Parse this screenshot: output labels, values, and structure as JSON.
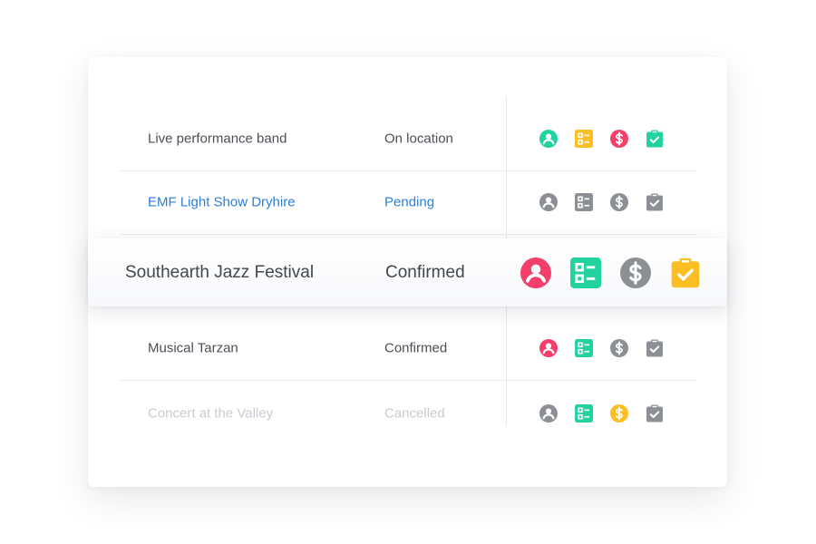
{
  "colors": {
    "teal": "#22d3a0",
    "yellow": "#fbbf24",
    "pink": "#f43f6b",
    "gray": "#8c8f94",
    "blue": "#2b7fd4",
    "faded_text": "#c8ccd2"
  },
  "rows": [
    {
      "name": "Live performance band",
      "status": "On location",
      "icons": [
        {
          "name": "person-icon",
          "color": "teal"
        },
        {
          "name": "checklist-icon",
          "color": "yellow"
        },
        {
          "name": "dollar-icon",
          "color": "pink"
        },
        {
          "name": "clipboard-check-icon",
          "color": "teal"
        }
      ]
    },
    {
      "name": "EMF Light Show Dryhire",
      "status": "Pending",
      "icons": [
        {
          "name": "person-icon",
          "color": "gray"
        },
        {
          "name": "checklist-icon",
          "color": "gray"
        },
        {
          "name": "dollar-icon",
          "color": "gray"
        },
        {
          "name": "clipboard-check-icon",
          "color": "gray"
        }
      ]
    },
    {
      "name": "Southearth Jazz Festival",
      "status": "Confirmed",
      "highlighted": true,
      "icons": [
        {
          "name": "person-icon",
          "color": "pink"
        },
        {
          "name": "checklist-icon",
          "color": "teal"
        },
        {
          "name": "dollar-icon",
          "color": "gray"
        },
        {
          "name": "clipboard-check-icon",
          "color": "yellow"
        }
      ]
    },
    {
      "name": "Musical Tarzan",
      "status": "Confirmed",
      "icons": [
        {
          "name": "person-icon",
          "color": "pink"
        },
        {
          "name": "checklist-icon",
          "color": "teal"
        },
        {
          "name": "dollar-icon",
          "color": "gray"
        },
        {
          "name": "clipboard-check-icon",
          "color": "gray"
        }
      ]
    },
    {
      "name": "Concert at the Valley",
      "status": "Cancelled",
      "icons": [
        {
          "name": "person-icon",
          "color": "gray"
        },
        {
          "name": "checklist-icon",
          "color": "teal"
        },
        {
          "name": "dollar-icon",
          "color": "yellow"
        },
        {
          "name": "clipboard-check-icon",
          "color": "gray"
        }
      ]
    }
  ]
}
